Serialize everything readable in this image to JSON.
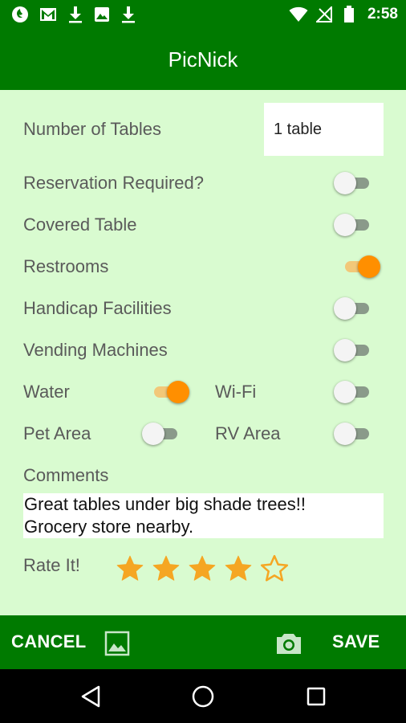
{
  "status_bar": {
    "time": "2:58",
    "left_icons": [
      "firefox-icon",
      "gmail-icon",
      "download-icon",
      "image-icon",
      "download-icon"
    ],
    "right_icons": [
      "wifi-icon",
      "no-signal-icon",
      "battery-icon"
    ]
  },
  "app_bar": {
    "title": "PicNick"
  },
  "form": {
    "tables_label": "Number of Tables",
    "tables_value": "1 table",
    "reservation_label": "Reservation Required?",
    "reservation_on": false,
    "covered_label": "Covered Table",
    "covered_on": false,
    "restrooms_label": "Restrooms",
    "restrooms_on": true,
    "handicap_label": "Handicap Facilities",
    "handicap_on": false,
    "vending_label": "Vending Machines",
    "vending_on": false,
    "water_label": "Water",
    "water_on": true,
    "wifi_label": "Wi-Fi",
    "wifi_on": false,
    "pet_label": "Pet Area",
    "pet_on": false,
    "rv_label": "RV Area",
    "rv_on": false,
    "comments_label": "Comments",
    "comments_text": "Great tables under big shade trees!!\nGrocery store nearby.",
    "rate_label": "Rate It!",
    "rating": 4,
    "rating_max": 5
  },
  "bottom_bar": {
    "cancel_label": "CANCEL",
    "save_label": "SAVE",
    "gallery_icon": "gallery-icon",
    "camera_icon": "camera-icon"
  },
  "nav_bar": {
    "icons": [
      "back-icon",
      "home-icon",
      "recents-icon"
    ]
  },
  "colors": {
    "primary": "#007a00",
    "background": "#d9fbd0",
    "accent": "#ff8f00",
    "star": "#f5a623"
  }
}
